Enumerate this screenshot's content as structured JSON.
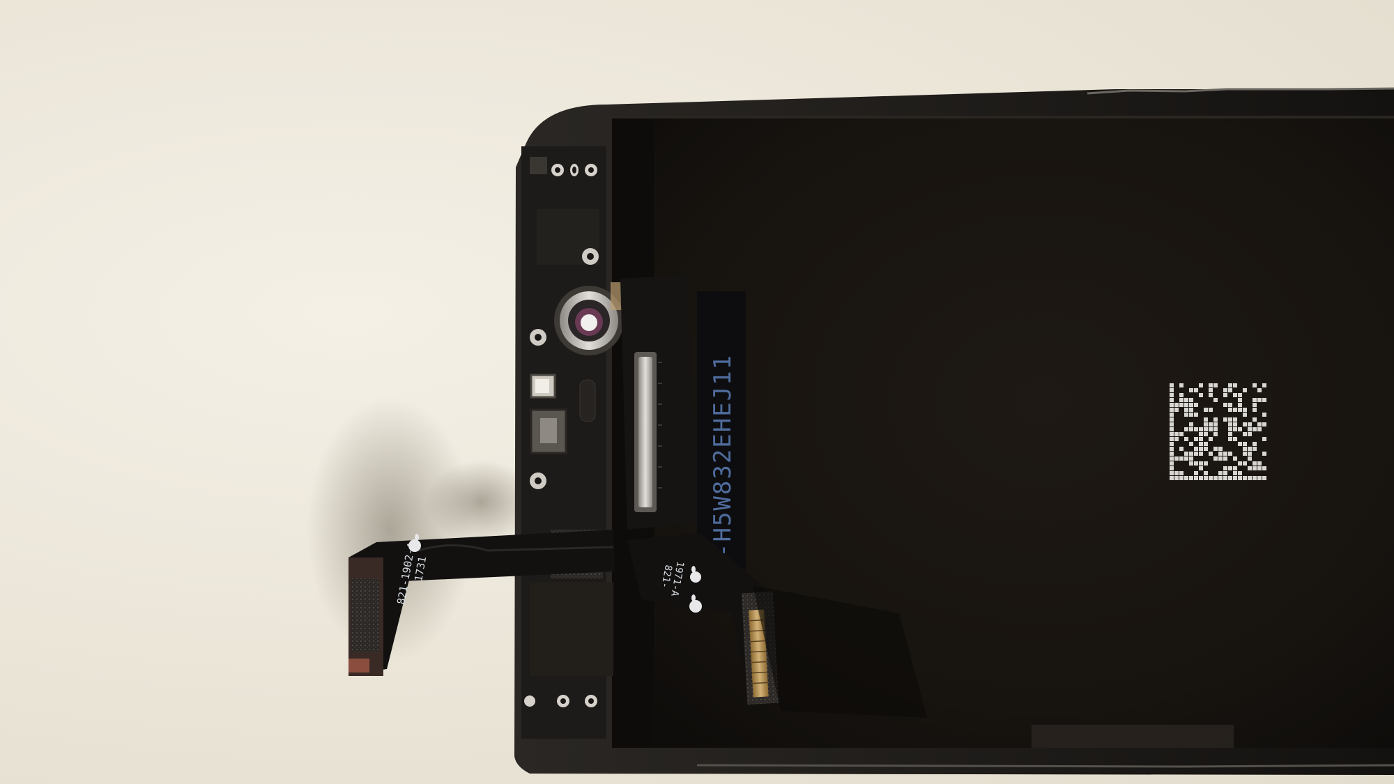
{
  "photo": {
    "subject": "Smartphone display assembly rear view with front camera and proximity sensor flex cable",
    "colors": {
      "surface": "#ece7dc",
      "frame": "#141311",
      "panel": "#1a1612",
      "flex": "#121110",
      "connector": "#b9955a",
      "serial_text": "#4f6c9c"
    }
  },
  "labels": {
    "flex_left_part": "821-1902-A",
    "flex_left_date": "1731",
    "flex_right_part": "821-",
    "flex_right_date": "1971-A",
    "panel_serial": "-H5W832EHEJ11"
  },
  "icons": [
    "apple-logo-icon",
    "datamatrix-code-icon",
    "front-camera-icon"
  ]
}
